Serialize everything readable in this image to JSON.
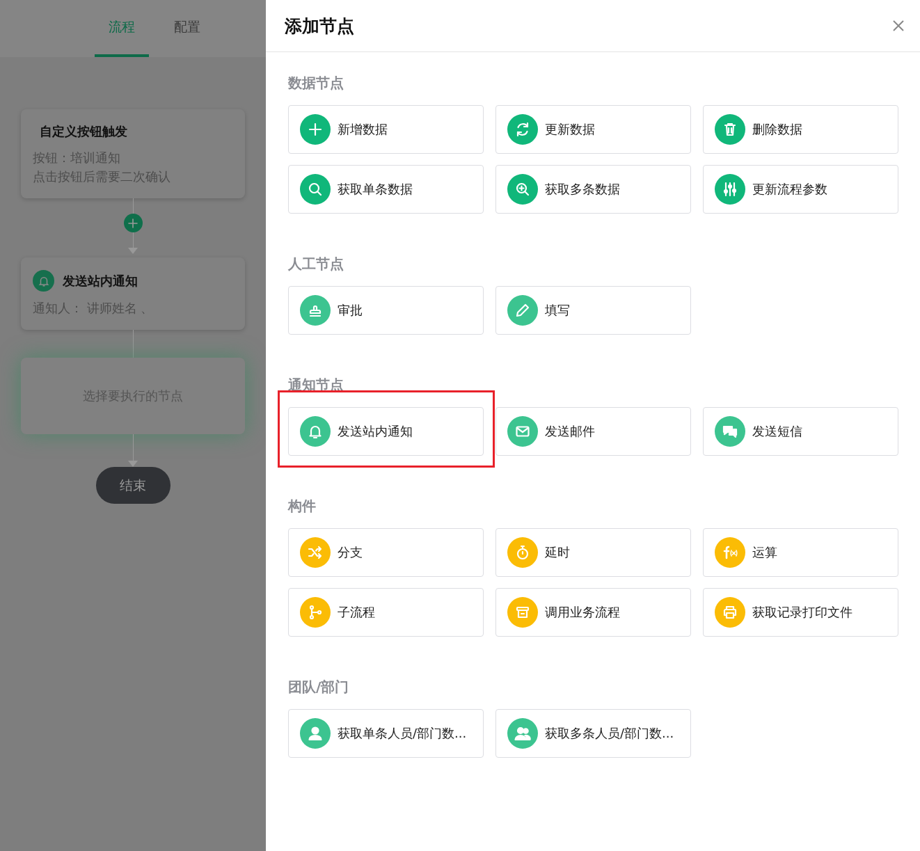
{
  "flow_panel": {
    "tabs": [
      {
        "label": "流程",
        "selected": true
      },
      {
        "label": "配置",
        "selected": false
      }
    ],
    "nodes": [
      {
        "kind": "trigger",
        "title": "自定义按钮触发",
        "lines": [
          "按钮：培训通知",
          "点击按钮后需要二次确认"
        ]
      },
      {
        "kind": "notify",
        "title": "发送站内通知",
        "lines": [
          "通知人：  讲师姓名 、"
        ]
      },
      {
        "kind": "placeholder",
        "title": "选择要执行的节点"
      }
    ],
    "end_label": "结束"
  },
  "drawer": {
    "title": "添加节点",
    "sections": [
      {
        "title": "数据节点",
        "items": [
          {
            "label": "新增数据",
            "kind": "plus",
            "color": "#10b77a",
            "highlighted": false
          },
          {
            "label": "更新数据",
            "kind": "refresh",
            "color": "#10b77a",
            "highlighted": false
          },
          {
            "label": "删除数据",
            "kind": "trash",
            "color": "#10b77a",
            "highlighted": false
          },
          {
            "label": "获取单条数据",
            "kind": "search",
            "color": "#10b77a",
            "highlighted": false
          },
          {
            "label": "获取多条数据",
            "kind": "zoom",
            "color": "#10b77a",
            "highlighted": false
          },
          {
            "label": "更新流程参数",
            "kind": "sliders",
            "color": "#10b77a",
            "highlighted": false
          }
        ]
      },
      {
        "title": "人工节点",
        "items": [
          {
            "label": "审批",
            "kind": "stamp",
            "color": "#3cc490",
            "highlighted": false
          },
          {
            "label": "填写",
            "kind": "pencil",
            "color": "#3cc490",
            "highlighted": false
          }
        ]
      },
      {
        "title": "通知节点",
        "items": [
          {
            "label": "发送站内通知",
            "kind": "bell",
            "color": "#3cc490",
            "highlighted": true
          },
          {
            "label": "发送邮件",
            "kind": "mail",
            "color": "#3cc490",
            "highlighted": false
          },
          {
            "label": "发送短信",
            "kind": "chat",
            "color": "#3cc490",
            "highlighted": false
          }
        ]
      },
      {
        "title": "构件",
        "items": [
          {
            "label": "分支",
            "kind": "shuffle",
            "color": "#fbbc05",
            "highlighted": false
          },
          {
            "label": "延时",
            "kind": "timer",
            "color": "#fbbc05",
            "highlighted": false
          },
          {
            "label": "运算",
            "kind": "function",
            "color": "#fbbc05",
            "highlighted": false
          },
          {
            "label": "子流程",
            "kind": "branch",
            "color": "#fbbc05",
            "highlighted": false
          },
          {
            "label": "调用业务流程",
            "kind": "archive",
            "color": "#fbbc05",
            "highlighted": false
          },
          {
            "label": "获取记录打印文件",
            "kind": "printer",
            "color": "#fbbc05",
            "highlighted": false
          }
        ]
      },
      {
        "title": "团队/部门",
        "items": [
          {
            "label": "获取单条人员/部门数...",
            "kind": "user",
            "color": "#3cc490",
            "highlighted": false
          },
          {
            "label": "获取多条人员/部门数...",
            "kind": "users",
            "color": "#3cc490",
            "highlighted": false
          }
        ]
      }
    ]
  }
}
